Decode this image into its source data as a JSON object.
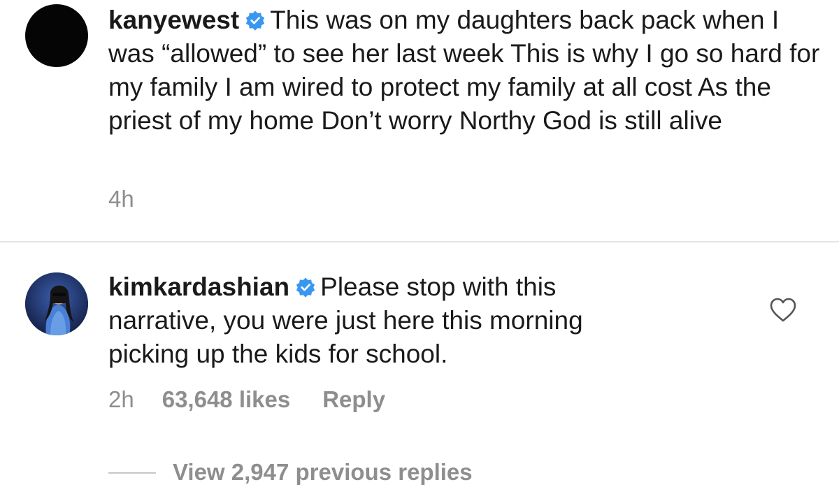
{
  "comments": [
    {
      "username": "kanyewest",
      "verified": true,
      "text": "This was on my daughters back pack when I was “allowed” to see her last week  This is why I go so hard for my family  I am wired to protect my family at all cost  As the priest of my home  Don’t worry Northy  God is still alive",
      "time": "4h",
      "avatar_icon": "avatar-black-circle"
    },
    {
      "username": "kimkardashian",
      "verified": true,
      "text": "Please stop with this narrative, you were just here this morning picking up the kids for school.",
      "time": "2h",
      "likes": "63,648 likes",
      "reply_label": "Reply",
      "like_icon": "heart-outline-icon",
      "avatar_icon": "avatar-photo",
      "view_replies": "View 2,947 previous replies"
    }
  ],
  "colors": {
    "text": "#1a1a1a",
    "meta": "#8e8e8e",
    "verified_badge": "#3897f0",
    "divider": "#e4e4e4"
  }
}
